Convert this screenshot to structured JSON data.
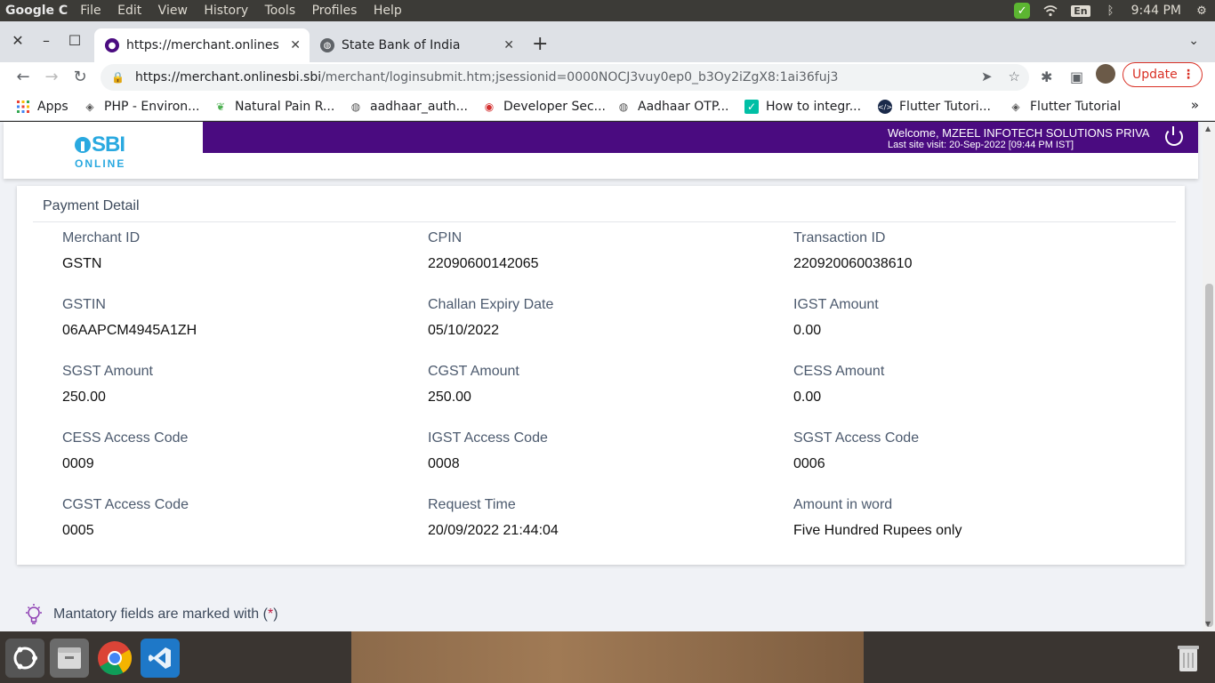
{
  "os_topbar": {
    "app_name": "Google C",
    "menu": [
      "File",
      "Edit",
      "View",
      "History",
      "Tools",
      "Profiles",
      "Help"
    ],
    "lang": "En",
    "time": "9:44 PM"
  },
  "tabs": [
    {
      "title": "https://merchant.onlines",
      "active": true
    },
    {
      "title": "State Bank of India",
      "active": false
    }
  ],
  "omnibox": {
    "url_host": "https://merchant.onlinesbi.sbi",
    "url_path": "/merchant/loginsubmit.htm;jsessionid=0000NOCJ3vuy0ep0_b3Oy2iZgX8:1ai36fuj3"
  },
  "toolbar": {
    "update_label": "Update"
  },
  "bookmarks": [
    {
      "label": "Apps"
    },
    {
      "label": "PHP - Environ..."
    },
    {
      "label": "Natural Pain R..."
    },
    {
      "label": "aadhaar_auth..."
    },
    {
      "label": "Developer Sec..."
    },
    {
      "label": "Aadhaar OTP..."
    },
    {
      "label": "How to integr..."
    },
    {
      "label": "Flutter Tutori..."
    },
    {
      "label": "Flutter Tutorial"
    }
  ],
  "sbi": {
    "logo_main": "SBI",
    "logo_sub": "ONLINE",
    "welcome": "Welcome, MZEEL INFOTECH SOLUTIONS PRIVA",
    "last_visit": "Last site visit: 20-Sep-2022 [09:44 PM IST]"
  },
  "payment": {
    "title": "Payment Detail",
    "fields": [
      {
        "label": "Merchant ID",
        "value": "GSTN"
      },
      {
        "label": "CPIN",
        "value": "22090600142065"
      },
      {
        "label": "Transaction ID",
        "value": "220920060038610"
      },
      {
        "label": "GSTIN",
        "value": "06AAPCM4945A1ZH"
      },
      {
        "label": "Challan Expiry Date",
        "value": "05/10/2022"
      },
      {
        "label": "IGST Amount",
        "value": "0.00"
      },
      {
        "label": "SGST Amount",
        "value": "250.00"
      },
      {
        "label": "CGST Amount",
        "value": "250.00"
      },
      {
        "label": "CESS Amount",
        "value": "0.00"
      },
      {
        "label": "CESS Access Code",
        "value": "0009"
      },
      {
        "label": "IGST Access Code",
        "value": "0008"
      },
      {
        "label": "SGST Access Code",
        "value": "0006"
      },
      {
        "label": "CGST Access Code",
        "value": "0005"
      },
      {
        "label": "Request Time",
        "value": "20/09/2022 21:44:04"
      },
      {
        "label": "Amount in word",
        "value": "Five Hundred Rupees only"
      }
    ]
  },
  "mandatory": {
    "text": "Mantatory fields are marked with (",
    "star": "*",
    "close": ")"
  },
  "colors": {
    "sbi_purple": "#4a0b80",
    "sbi_blue": "#2aa9e0",
    "update_red": "#d93025"
  }
}
